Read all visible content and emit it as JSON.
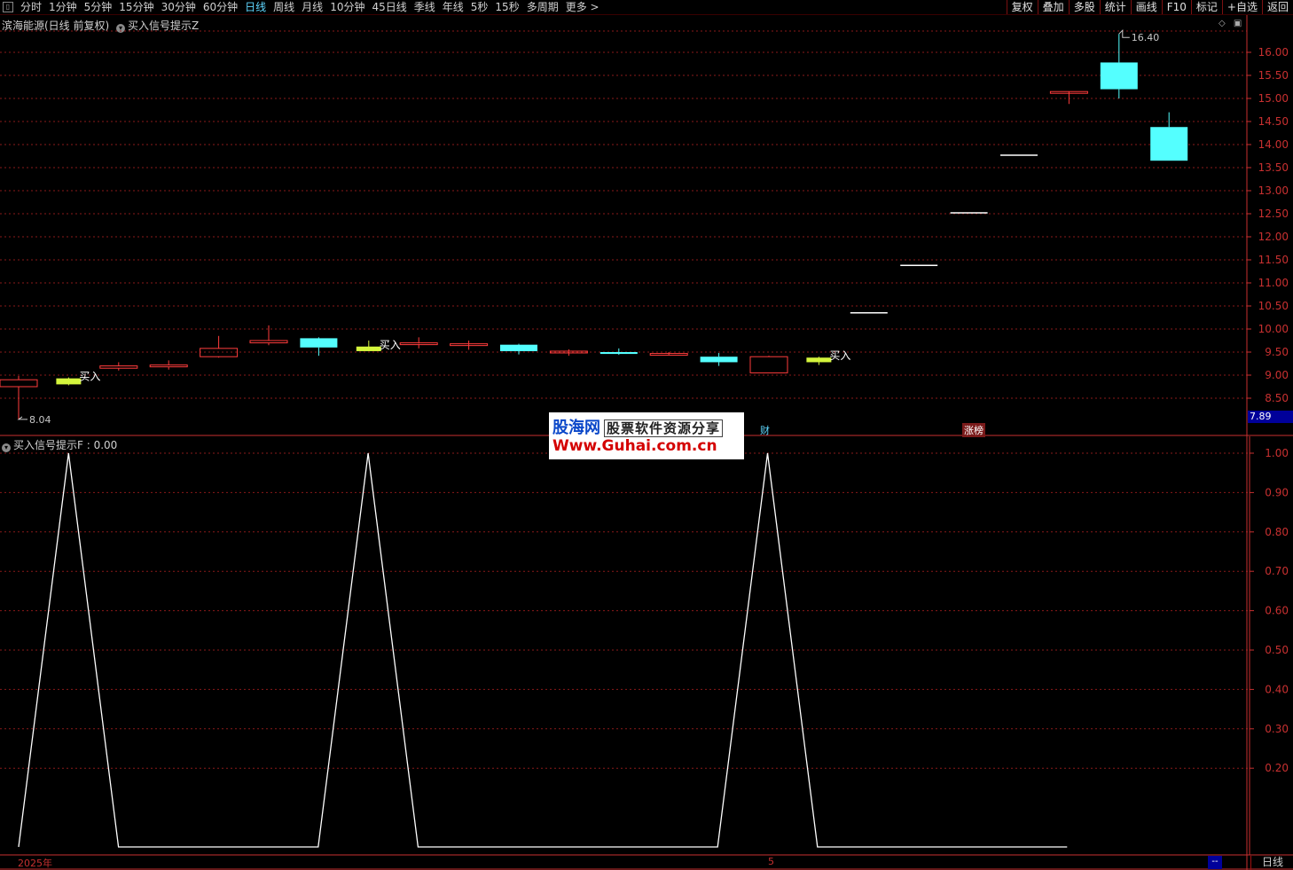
{
  "toolbar": {
    "periods": [
      "分时",
      "1分钟",
      "5分钟",
      "15分钟",
      "30分钟",
      "60分钟",
      "日线",
      "周线",
      "月线",
      "10分钟",
      "45日线",
      "季线",
      "年线",
      "5秒",
      "15秒",
      "多周期",
      "更多 >"
    ],
    "active_period": "日线",
    "buttons": [
      "复权",
      "叠加",
      "多股",
      "统计",
      "画线",
      "F10",
      "标记",
      "+自选",
      "返回"
    ]
  },
  "main_chart": {
    "title": "滨海能源(日线 前复权)",
    "indicator": "买入信号提示Z",
    "high_label": "16.40",
    "low_label": "8.04",
    "signal_label": "买入",
    "current_price": "7.89",
    "event_labels": {
      "finance": "财",
      "limit_list": "涨榜"
    }
  },
  "sub_chart": {
    "title": "买入信号提示F",
    "value": ": 0.00"
  },
  "watermark": {
    "brand": "股海网",
    "slogan": "股票软件资源分享",
    "url": "Www.Guhai.com.cn"
  },
  "bottom_bar": {
    "year": "2025年",
    "month_marker": "5",
    "dash": "--",
    "period": "日线"
  },
  "colors": {
    "up": "#ff3c3c",
    "down": "#54ffff",
    "signal": "#d4f53c",
    "grid": "#8a1a1a",
    "axis": "#c83030"
  },
  "chart_data": [
    {
      "type": "candlestick",
      "title": "滨海能源(日线 前复权)",
      "ylim": [
        7.9,
        16.6
      ],
      "yticks": [
        8.5,
        9.0,
        9.5,
        10.0,
        10.5,
        11.0,
        11.5,
        12.0,
        12.5,
        13.0,
        13.5,
        14.0,
        14.5,
        15.0,
        15.5,
        16.0
      ],
      "candles": [
        {
          "o": 8.75,
          "h": 8.98,
          "l": 8.04,
          "c": 8.9
        },
        {
          "o": 8.93,
          "h": 8.95,
          "l": 8.78,
          "c": 8.8
        },
        {
          "o": 9.15,
          "h": 9.28,
          "l": 9.1,
          "c": 9.2
        },
        {
          "o": 9.18,
          "h": 9.32,
          "l": 9.12,
          "c": 9.22
        },
        {
          "o": 9.4,
          "h": 9.85,
          "l": 9.38,
          "c": 9.58
        },
        {
          "o": 9.7,
          "h": 10.08,
          "l": 9.65,
          "c": 9.75
        },
        {
          "o": 9.8,
          "h": 9.82,
          "l": 9.42,
          "c": 9.6
        },
        {
          "o": 9.52,
          "h": 9.75,
          "l": 9.52,
          "c": 9.62
        },
        {
          "o": 9.68,
          "h": 9.82,
          "l": 9.58,
          "c": 9.7
        },
        {
          "o": 9.68,
          "h": 9.75,
          "l": 9.55,
          "c": 9.68
        },
        {
          "o": 9.66,
          "h": 9.68,
          "l": 9.45,
          "c": 9.52
        },
        {
          "o": 9.5,
          "h": 9.56,
          "l": 9.42,
          "c": 9.52
        },
        {
          "o": 9.5,
          "h": 9.58,
          "l": 9.44,
          "c": 9.46
        },
        {
          "o": 9.47,
          "h": 9.5,
          "l": 9.44,
          "c": 9.47
        },
        {
          "o": 9.4,
          "h": 9.48,
          "l": 9.2,
          "c": 9.28
        },
        {
          "o": 9.05,
          "h": 9.42,
          "l": 9.05,
          "c": 9.4
        },
        {
          "o": 9.38,
          "h": 9.4,
          "l": 9.22,
          "c": 9.28
        },
        {
          "o": 10.35,
          "h": 10.35,
          "l": 10.35,
          "c": 10.35
        },
        {
          "o": 11.38,
          "h": 11.38,
          "l": 11.38,
          "c": 11.38
        },
        {
          "o": 12.52,
          "h": 12.52,
          "l": 12.52,
          "c": 12.52
        },
        {
          "o": 13.77,
          "h": 13.77,
          "l": 13.77,
          "c": 13.77
        },
        {
          "o": 15.15,
          "h": 15.15,
          "l": 14.88,
          "c": 15.15
        },
        {
          "o": 15.78,
          "h": 16.4,
          "l": 15.0,
          "c": 15.2
        },
        {
          "o": 14.38,
          "h": 14.7,
          "l": 13.65,
          "c": 13.65
        }
      ],
      "signal_candles": [
        1,
        7,
        16
      ]
    },
    {
      "type": "line",
      "title": "买入信号提示F",
      "ylim": [
        0.0,
        1.05
      ],
      "yticks": [
        0.2,
        0.3,
        0.4,
        0.5,
        0.6,
        0.7,
        0.8,
        0.9,
        1.0
      ],
      "values": [
        0,
        1,
        0,
        0,
        0,
        0,
        0,
        1,
        0,
        0,
        0,
        0,
        0,
        0,
        0,
        1,
        0,
        0,
        0,
        0,
        0,
        0
      ]
    }
  ]
}
